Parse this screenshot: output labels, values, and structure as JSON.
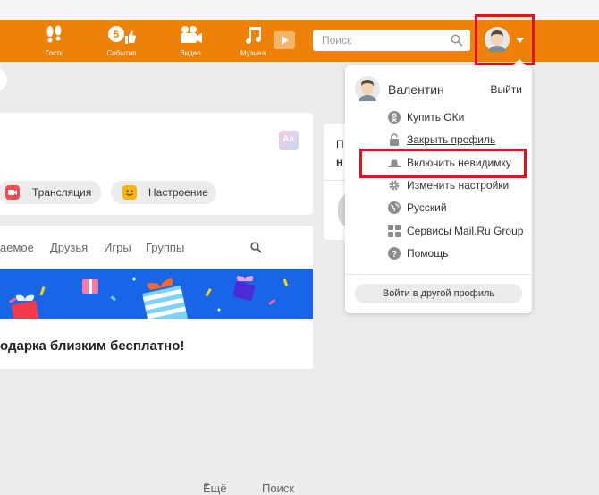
{
  "header": {
    "nav": [
      {
        "label": "Гости"
      },
      {
        "label": "События",
        "badge": "5"
      },
      {
        "label": "Видео"
      },
      {
        "label": "Музыка"
      }
    ],
    "search": {
      "placeholder": "Поиск"
    }
  },
  "feed": {
    "post_box": {
      "actions": [
        {
          "label": "Трансляция"
        },
        {
          "label": "Настроение"
        }
      ]
    },
    "tabs": [
      "аемое",
      "Друзья",
      "Игры",
      "Группы",
      "Ещё",
      "Поиск"
    ],
    "promo_text": "одарка близким бесплатно!",
    "side_card_partial": [
      "П",
      "н"
    ]
  },
  "profile_menu": {
    "user_name": "Валентин",
    "logout_label": "Выйти",
    "items": [
      {
        "label": "Купить ОКи",
        "icon": "ok-coin-icon"
      },
      {
        "label": "Закрыть профиль",
        "icon": "lock-icon"
      },
      {
        "label": "Включить невидимку",
        "icon": "hat-icon"
      },
      {
        "label": "Изменить настройки",
        "icon": "gear-icon"
      },
      {
        "label": "Русский",
        "icon": "globe-icon"
      },
      {
        "label": "Сервисы Mail.Ru Group",
        "icon": "grid-icon"
      },
      {
        "label": "Помощь",
        "icon": "help-icon"
      }
    ],
    "switch_profile_label": "Войти в другой профиль"
  },
  "colors": {
    "header_bg": "#ee8208",
    "highlight": "#e0141e",
    "banner_bg": "#1866e8"
  }
}
